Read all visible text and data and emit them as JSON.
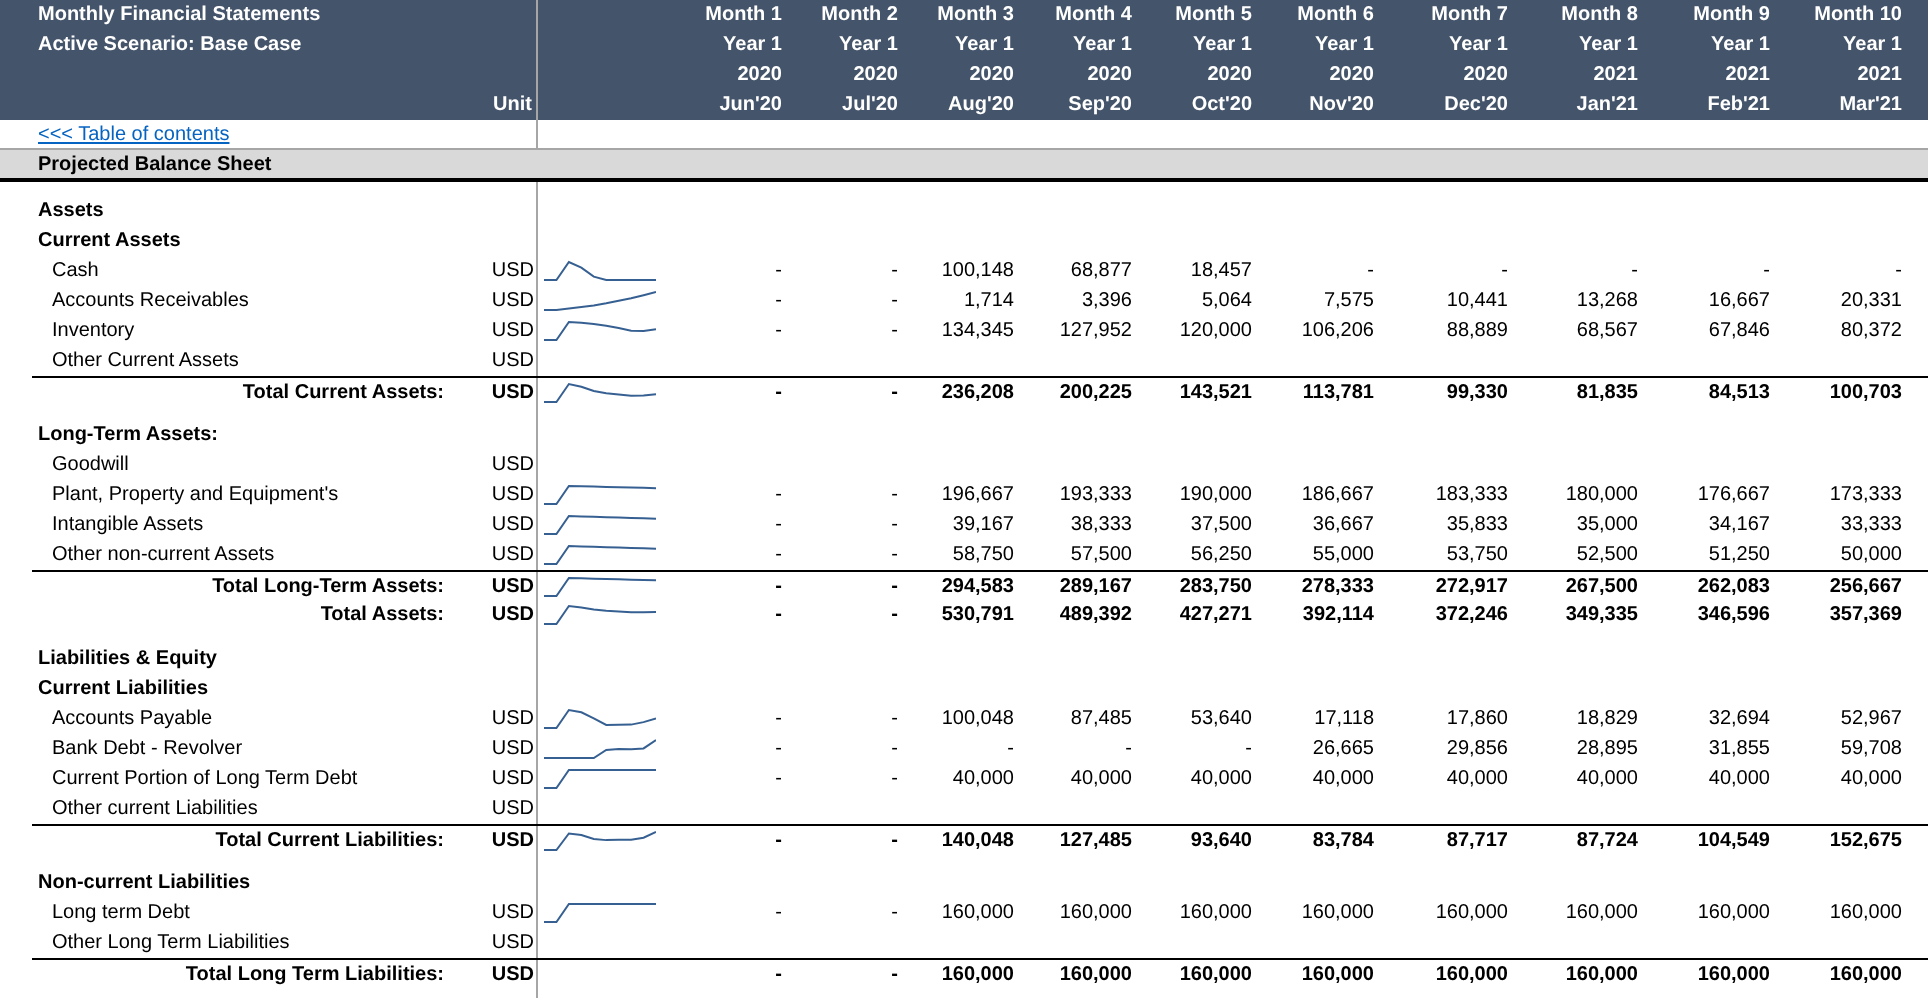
{
  "header": {
    "title": "Monthly Financial Statements",
    "subtitle": "Active Scenario: Base Case",
    "unit_label": "Unit",
    "columns": [
      {
        "month": "Month 1",
        "year": "Year 1",
        "calendar_year": "2020",
        "date": "Jun'20"
      },
      {
        "month": "Month 2",
        "year": "Year 1",
        "calendar_year": "2020",
        "date": "Jul'20"
      },
      {
        "month": "Month 3",
        "year": "Year 1",
        "calendar_year": "2020",
        "date": "Aug'20"
      },
      {
        "month": "Month 4",
        "year": "Year 1",
        "calendar_year": "2020",
        "date": "Sep'20"
      },
      {
        "month": "Month 5",
        "year": "Year 1",
        "calendar_year": "2020",
        "date": "Oct'20"
      },
      {
        "month": "Month 6",
        "year": "Year 1",
        "calendar_year": "2020",
        "date": "Nov'20"
      },
      {
        "month": "Month 7",
        "year": "Year 1",
        "calendar_year": "2020",
        "date": "Dec'20"
      },
      {
        "month": "Month 8",
        "year": "Year 1",
        "calendar_year": "2021",
        "date": "Jan'21"
      },
      {
        "month": "Month 9",
        "year": "Year 1",
        "calendar_year": "2021",
        "date": "Feb'21"
      },
      {
        "month": "Month 10",
        "year": "Year 1",
        "calendar_year": "2021",
        "date": "Mar'21"
      }
    ]
  },
  "toc_link": "<<< Table of contents",
  "section_title": "Projected Balance Sheet",
  "groups": [
    {
      "rows": [
        {
          "kind": "heading",
          "label": "Assets"
        },
        {
          "kind": "heading",
          "label": "Current Assets"
        },
        {
          "kind": "item",
          "label": "Cash",
          "unit": "USD",
          "sparkline": true,
          "values": [
            "-",
            "-",
            "100,148",
            "68,877",
            "18,457",
            "-",
            "-",
            "-",
            "-",
            "-"
          ]
        },
        {
          "kind": "item",
          "label": "Accounts Receivables",
          "unit": "USD",
          "sparkline": true,
          "values": [
            "-",
            "-",
            "1,714",
            "3,396",
            "5,064",
            "7,575",
            "10,441",
            "13,268",
            "16,667",
            "20,331"
          ]
        },
        {
          "kind": "item",
          "label": "Inventory",
          "unit": "USD",
          "sparkline": true,
          "values": [
            "-",
            "-",
            "134,345",
            "127,952",
            "120,000",
            "106,206",
            "88,889",
            "68,567",
            "67,846",
            "80,372"
          ]
        },
        {
          "kind": "item",
          "label": "Other Current Assets",
          "unit": "USD"
        },
        {
          "kind": "subtotal",
          "label": "Total Current Assets:",
          "unit": "USD",
          "sparkline": true,
          "values": [
            "-",
            "-",
            "236,208",
            "200,225",
            "143,521",
            "113,781",
            "99,330",
            "81,835",
            "84,513",
            "100,703"
          ]
        }
      ]
    },
    {
      "rows": [
        {
          "kind": "heading",
          "label": "Long-Term Assets:"
        },
        {
          "kind": "item",
          "label": "Goodwill",
          "unit": "USD"
        },
        {
          "kind": "item",
          "label": "Plant, Property and Equipment's",
          "unit": "USD",
          "sparkline": true,
          "values": [
            "-",
            "-",
            "196,667",
            "193,333",
            "190,000",
            "186,667",
            "183,333",
            "180,000",
            "176,667",
            "173,333"
          ]
        },
        {
          "kind": "item",
          "label": "Intangible Assets",
          "unit": "USD",
          "sparkline": true,
          "values": [
            "-",
            "-",
            "39,167",
            "38,333",
            "37,500",
            "36,667",
            "35,833",
            "35,000",
            "34,167",
            "33,333"
          ]
        },
        {
          "kind": "item",
          "label": "Other non-current Assets",
          "unit": "USD",
          "sparkline": true,
          "values": [
            "-",
            "-",
            "58,750",
            "57,500",
            "56,250",
            "55,000",
            "53,750",
            "52,500",
            "51,250",
            "50,000"
          ]
        },
        {
          "kind": "subtotal",
          "label": "Total Long-Term Assets:",
          "unit": "USD",
          "sparkline": true,
          "values": [
            "-",
            "-",
            "294,583",
            "289,167",
            "283,750",
            "278,333",
            "272,917",
            "267,500",
            "262,083",
            "256,667"
          ]
        },
        {
          "kind": "total",
          "label": "Total Assets:",
          "unit": "USD",
          "sparkline": true,
          "values": [
            "-",
            "-",
            "530,791",
            "489,392",
            "427,271",
            "392,114",
            "372,246",
            "349,335",
            "346,596",
            "357,369"
          ]
        }
      ]
    },
    {
      "rows": [
        {
          "kind": "heading",
          "label": "Liabilities & Equity"
        },
        {
          "kind": "heading",
          "label": "Current Liabilities"
        },
        {
          "kind": "item",
          "label": "Accounts Payable",
          "unit": "USD",
          "sparkline": true,
          "values": [
            "-",
            "-",
            "100,048",
            "87,485",
            "53,640",
            "17,118",
            "17,860",
            "18,829",
            "32,694",
            "52,967"
          ]
        },
        {
          "kind": "item",
          "label": "Bank Debt - Revolver",
          "unit": "USD",
          "sparkline": true,
          "values": [
            "-",
            "-",
            "-",
            "-",
            "-",
            "26,665",
            "29,856",
            "28,895",
            "31,855",
            "59,708"
          ]
        },
        {
          "kind": "item",
          "label": "Current Portion of Long Term Debt",
          "unit": "USD",
          "sparkline": true,
          "values": [
            "-",
            "-",
            "40,000",
            "40,000",
            "40,000",
            "40,000",
            "40,000",
            "40,000",
            "40,000",
            "40,000"
          ]
        },
        {
          "kind": "item",
          "label": "Other current Liabilities",
          "unit": "USD"
        },
        {
          "kind": "subtotal",
          "label": "Total Current Liabilities:",
          "unit": "USD",
          "sparkline": true,
          "values": [
            "-",
            "-",
            "140,048",
            "127,485",
            "93,640",
            "83,784",
            "87,717",
            "87,724",
            "104,549",
            "152,675"
          ]
        }
      ]
    },
    {
      "rows": [
        {
          "kind": "heading",
          "label": "Non-current Liabilities"
        },
        {
          "kind": "item",
          "label": "Long term Debt",
          "unit": "USD",
          "sparkline": true,
          "values": [
            "-",
            "-",
            "160,000",
            "160,000",
            "160,000",
            "160,000",
            "160,000",
            "160,000",
            "160,000",
            "160,000"
          ]
        },
        {
          "kind": "item",
          "label": "Other Long Term Liabilities",
          "unit": "USD"
        },
        {
          "kind": "subtotal",
          "label": "Total Long Term Liabilities:",
          "unit": "USD",
          "sparkline": false,
          "values": [
            "-",
            "-",
            "160,000",
            "160,000",
            "160,000",
            "160,000",
            "160,000",
            "160,000",
            "160,000",
            "160,000"
          ]
        }
      ]
    }
  ]
}
